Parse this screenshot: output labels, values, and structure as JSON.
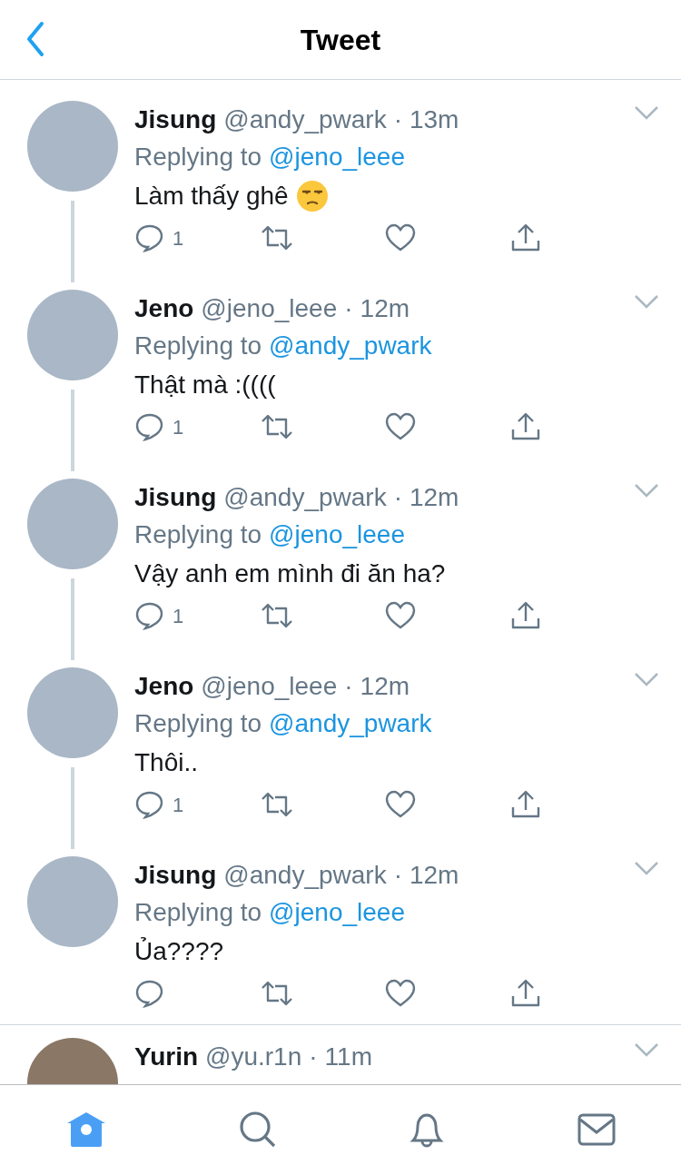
{
  "header": {
    "title": "Tweet"
  },
  "tweets": [
    {
      "name": "Jisung",
      "handle": "@andy_pwark",
      "dot": "·",
      "time": "13m",
      "replying_label": "Replying to",
      "replying_to": "@jeno_leee",
      "text": "Làm thấy ghê",
      "emoji_icon": true,
      "replies": "1"
    },
    {
      "name": "Jeno",
      "handle": "@jeno_leee",
      "dot": "·",
      "time": "12m",
      "replying_label": "Replying to",
      "replying_to": "@andy_pwark",
      "text": "Thật mà :((((",
      "emoji_icon": false,
      "replies": "1"
    },
    {
      "name": "Jisung",
      "handle": "@andy_pwark",
      "dot": "·",
      "time": "12m",
      "replying_label": "Replying to",
      "replying_to": "@jeno_leee",
      "text": "Vậy anh em mình đi ăn ha?",
      "emoji_icon": false,
      "replies": "1"
    },
    {
      "name": "Jeno",
      "handle": "@jeno_leee",
      "dot": "·",
      "time": "12m",
      "replying_label": "Replying to",
      "replying_to": "@andy_pwark",
      "text": "Thôi..",
      "emoji_icon": false,
      "replies": "1"
    },
    {
      "name": "Jisung",
      "handle": "@andy_pwark",
      "dot": "·",
      "time": "12m",
      "replying_label": "Replying to",
      "replying_to": "@jeno_leee",
      "text": "Ủa????",
      "emoji_icon": false
    }
  ],
  "next_tweet": {
    "name": "Yurin",
    "handle": "@yu.r1n",
    "dot": "·",
    "time": "11m"
  },
  "tabbar": [
    {
      "kind": "home",
      "selected": true
    },
    {
      "kind": "search",
      "selected": false
    },
    {
      "kind": "notifications",
      "selected": false
    },
    {
      "kind": "messages",
      "selected": false
    }
  ]
}
